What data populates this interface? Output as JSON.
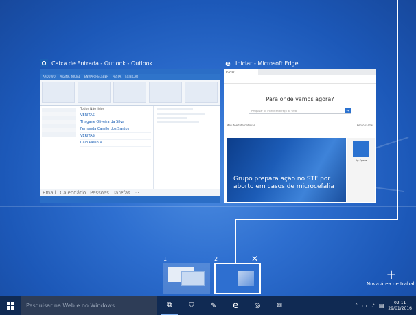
{
  "windows": {
    "outlook": {
      "title": "Caixa de Entrada - Outlook - Outlook",
      "icon": "outlook-icon",
      "tabs": [
        "ARQUIVO",
        "PÁGINA INICIAL",
        "ENVIAR/RECEBER",
        "PASTA",
        "EXIBIÇÃO"
      ],
      "list_header": "Todos   Não lidos",
      "mails": [
        {
          "sender": "VERITAS",
          "preview": ""
        },
        {
          "sender": "Thagane Oliveira da Silva",
          "preview": ""
        },
        {
          "sender": "Fernanda Camilo dos Santos",
          "preview": ""
        },
        {
          "sender": "VERITAS",
          "preview": ""
        },
        {
          "sender": "Caio Passo V",
          "preview": ""
        }
      ],
      "footer": [
        "Email",
        "Calendário",
        "Pessoas",
        "Tarefas",
        "···"
      ]
    },
    "edge": {
      "title": "Iniciar - Microsoft Edge",
      "icon": "edge-icon",
      "tab_label": "Iniciar",
      "question": "Para onde vamos agora?",
      "search_placeholder": "Pesquisar ou inserir endereço da Web",
      "feed_title": "Meu feed de notícias",
      "feed_action": "Personalizar",
      "headline": "Grupo prepara ação no STF por aborto em casos de microcefalia",
      "side_tile": "Up Space"
    }
  },
  "virtual_desktops": [
    {
      "number": "1"
    },
    {
      "number": "2"
    }
  ],
  "close_glyph": "✕",
  "new_desktop": {
    "plus": "+",
    "label": "Nova área de trabalho"
  },
  "taskbar": {
    "search_placeholder": "Pesquisar na Web e no Windows",
    "clock_time": "02:11",
    "clock_date": "29/01/2016"
  },
  "colors": {
    "accent": "#2e6fd0",
    "taskbar": "#102a53"
  }
}
